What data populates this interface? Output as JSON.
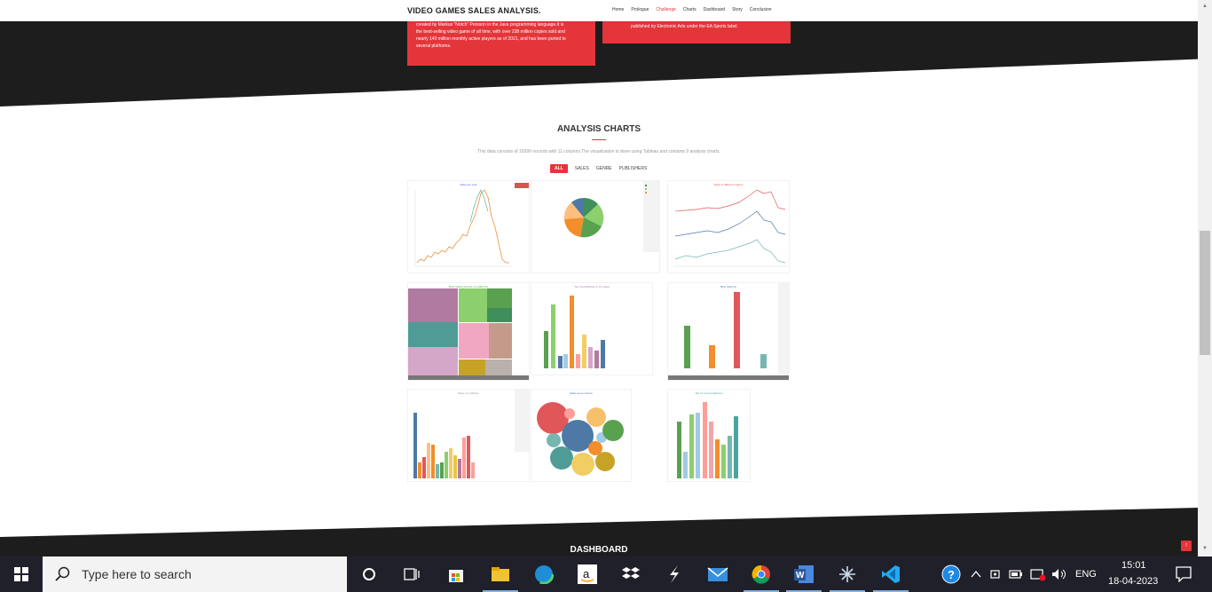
{
  "header": {
    "brand": "VIDEO GAMES SALES ANALYSIS.",
    "nav": [
      "Home",
      "Prologue",
      "Challenge",
      "Charts",
      "Dashboard",
      "Story",
      "Conclusion"
    ],
    "active_nav": "Challenge"
  },
  "cards": {
    "left_text": [
      "created by Markus \"Notch\" Persson in the Java programming language.It is",
      "the best-selling video game of all time, with over 238 million copies sold and",
      "nearly 140 million monthly active players as of 2021, and has been ported to",
      "several platforms."
    ],
    "right_text": "published by Electronic Arts under the EA Sports label."
  },
  "analysis": {
    "title": "ANALYSIS CHARTS",
    "description": "This data consists of 16599 records with 11 columns.The visualization is done using Tableau and contains 9 analysis charts.",
    "filters": [
      "ALL",
      "SALES",
      "GENRE",
      "PUBLISHERS"
    ],
    "active_filter": "ALL",
    "thumbnails": [
      {
        "title": "Sales per year",
        "kind": "line"
      },
      {
        "title": "",
        "kind": "pie"
      },
      {
        "title": "Sales in different regions",
        "kind": "multi-line"
      },
      {
        "title": "Best Selling Games on platforms",
        "kind": "treemap"
      },
      {
        "title": "Top 20 publishers in 10 mega",
        "kind": "bar"
      },
      {
        "title": "Best sales by",
        "kind": "bar"
      },
      {
        "title": "Sales per platform",
        "kind": "bar"
      },
      {
        "title": "Sales as per Genre",
        "kind": "bubble"
      },
      {
        "title": "Top 10 recent platforms",
        "kind": "bar"
      }
    ]
  },
  "dashboard": {
    "title": "DASHBOARD"
  },
  "taskbar": {
    "search_placeholder": "Type here to search",
    "language": "ENG",
    "time": "15:01",
    "date": "18-04-2023"
  },
  "colors": {
    "accent": "#e4353b",
    "dark": "#1d1d1d",
    "taskbar": "#20202a"
  }
}
